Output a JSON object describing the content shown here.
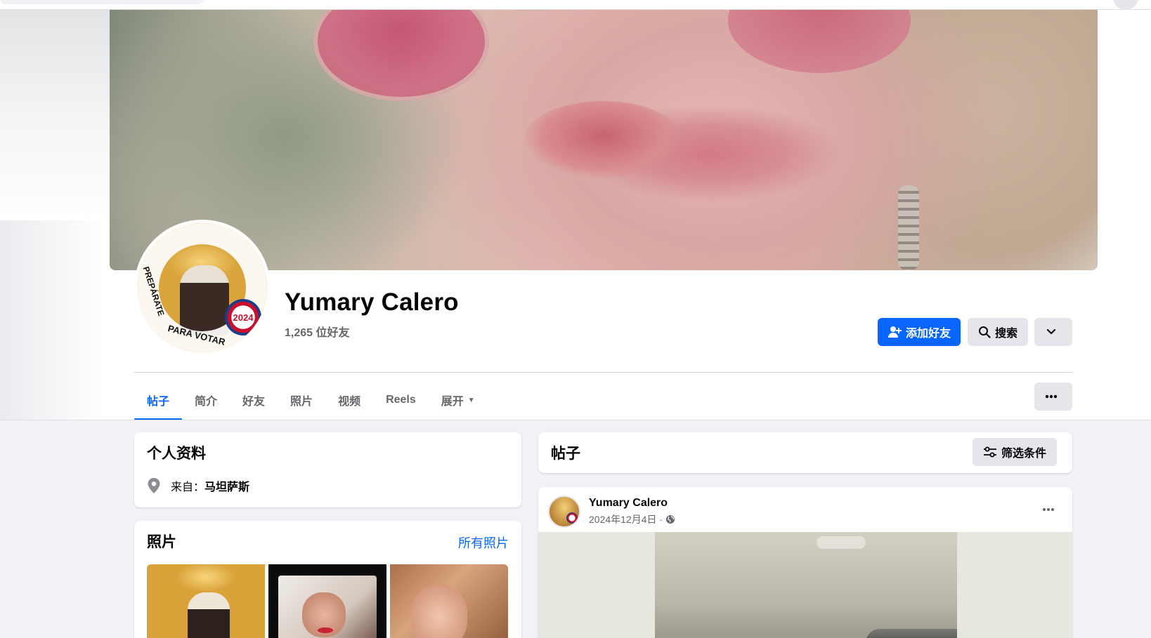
{
  "profile": {
    "name": "Yumary Calero",
    "friends_count": "1,265 位好友",
    "avatar_text_arc1": "PREPÁRATE",
    "avatar_text_arc2": "PARA VOTAR",
    "avatar_badge": "2024"
  },
  "actions": {
    "add_friend": "添加好友",
    "search": "搜索"
  },
  "tabs": [
    {
      "label": "帖子",
      "active": true
    },
    {
      "label": "简介"
    },
    {
      "label": "好友"
    },
    {
      "label": "照片"
    },
    {
      "label": "视频"
    },
    {
      "label": "Reels"
    },
    {
      "label": "展开"
    }
  ],
  "intro": {
    "title": "个人资料",
    "from_label": "来自：",
    "from_value": "马坦萨斯"
  },
  "photos": {
    "title": "照片",
    "all_link": "所有照片"
  },
  "posts": {
    "title": "帖子",
    "filter_label": "筛选条件"
  },
  "post": {
    "author": "Yumary Calero",
    "date": "2024年12月4日 ·",
    "privacy_icon": "globe-icon"
  },
  "colors": {
    "accent": "#0866ff",
    "secondary_button": "#e4e6eb",
    "page_bg": "#f0f2f5",
    "muted_text": "#65676b"
  }
}
